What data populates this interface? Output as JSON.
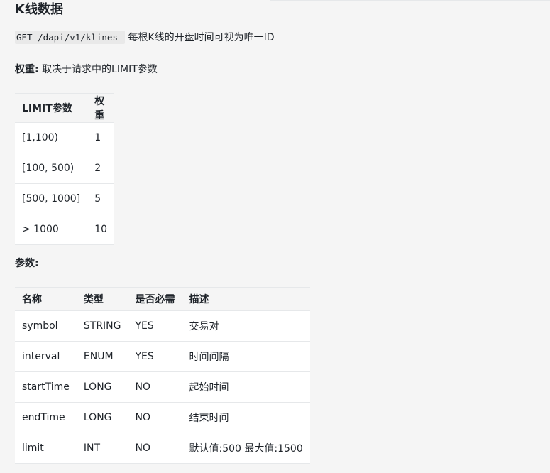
{
  "title": "K线数据",
  "endpoint": {
    "path": "GET /dapi/v1/klines",
    "description": "每根K线的开盘时间可视为唯一ID"
  },
  "weight": {
    "label": "权重:",
    "text": "取决于请求中的LIMIT参数"
  },
  "limit_table": {
    "headers": [
      "LIMIT参数",
      "权重"
    ],
    "rows": [
      [
        "[1,100)",
        "1"
      ],
      [
        "[100, 500)",
        "2"
      ],
      [
        "[500, 1000]",
        "5"
      ],
      [
        "> 1000",
        "10"
      ]
    ]
  },
  "params_heading": "参数:",
  "params_table": {
    "headers": [
      "名称",
      "类型",
      "是否必需",
      "描述"
    ],
    "rows": [
      [
        "symbol",
        "STRING",
        "YES",
        "交易对"
      ],
      [
        "interval",
        "ENUM",
        "YES",
        "时间间隔"
      ],
      [
        "startTime",
        "LONG",
        "NO",
        "起始时间"
      ],
      [
        "endTime",
        "LONG",
        "NO",
        "结束时间"
      ],
      [
        "limit",
        "INT",
        "NO",
        "默认值:500 最大值:1500"
      ]
    ]
  }
}
